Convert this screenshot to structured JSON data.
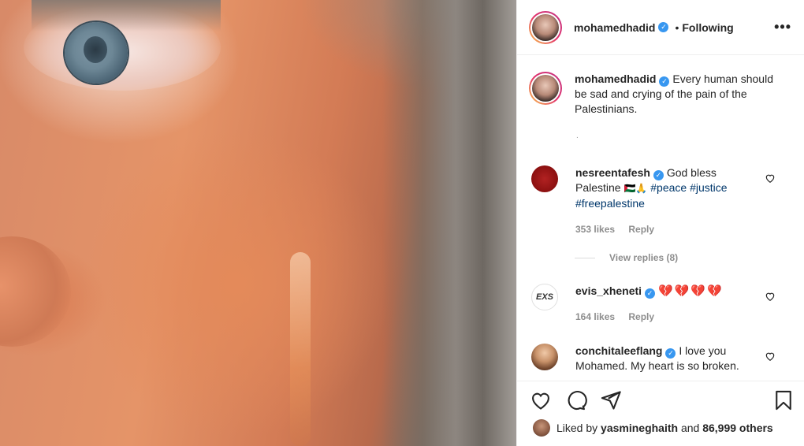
{
  "post": {
    "username": "mohamedhadid",
    "following_label": "Following",
    "dot": "•",
    "more_label": "•••",
    "caption": "Every human should be sad and crying of the pain of the Palestinians.",
    "caption_dot": "."
  },
  "comments": [
    {
      "username": "nesreentafesh",
      "text_pre": "God bless Palestine ",
      "emoji": "🇵🇸🙏",
      "tags": [
        "#peace",
        "#justice",
        "#freepalestine"
      ],
      "likes": "353 likes",
      "reply": "Reply",
      "view_replies": "View replies (8)"
    },
    {
      "username": "evis_xheneti",
      "hearts": "💔💔💔💔",
      "likes": "164 likes",
      "reply": "Reply",
      "avatar_text": "EXS"
    },
    {
      "username": "conchitaleeflang",
      "text": "I love you Mohamed. My heart is so broken."
    }
  ],
  "likes_summary": {
    "prefix": "Liked by",
    "user": "yasmineghaith",
    "and": "and",
    "others": "86,999 others"
  },
  "icons": {
    "verified": "verified-badge-icon",
    "heart": "heart-icon",
    "comment": "comment-icon",
    "share": "share-icon",
    "save": "bookmark-icon"
  }
}
